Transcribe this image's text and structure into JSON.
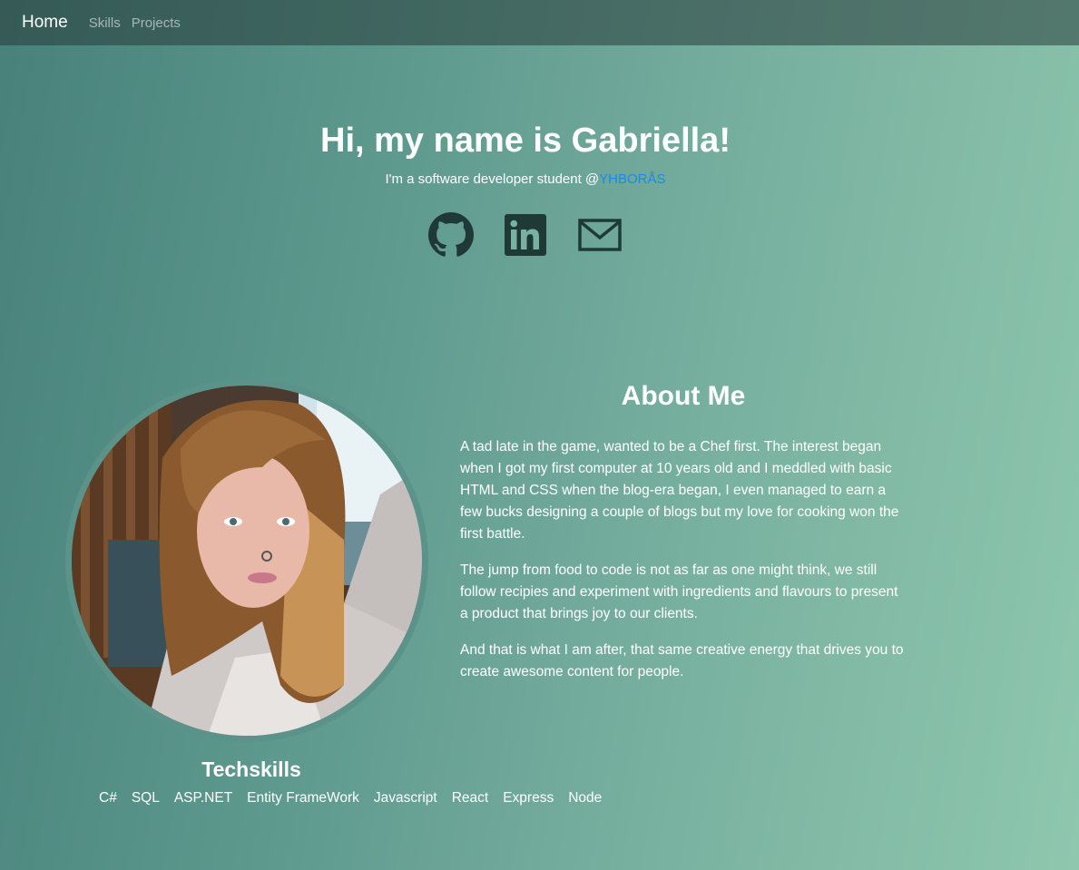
{
  "nav": {
    "brand": "Home",
    "links": [
      "Skills",
      "Projects"
    ]
  },
  "hero": {
    "title": "Hi, my name is Gabriella!",
    "subtitle_prefix": "I'm a software developer student @",
    "subtitle_link": "YHBORÅS",
    "social_icons": [
      "github-icon",
      "linkedin-icon",
      "mail-icon"
    ]
  },
  "about": {
    "title": "About Me",
    "paragraphs": [
      "A tad late in the game, wanted to be a Chef first. The interest began when I got my first computer at 10 years old and I meddled with basic HTML and CSS when the blog-era began, I even managed to earn a few bucks designing a couple of blogs but my love for cooking won the first battle.",
      "The jump from food to code is not as far as one might think, we still follow recipies and experiment with ingredients and flavours to present a product that brings joy to our clients.",
      "And that is what I am after, that same creative energy that drives you to create awesome content for people."
    ]
  },
  "skills": {
    "title": "Techskills",
    "items": [
      "C#",
      "SQL",
      "ASP.NET",
      "Entity FrameWork",
      "Javascript",
      "React",
      "Express",
      "Node"
    ]
  },
  "colors": {
    "link": "#1e88e5",
    "icon": "#1f3a36",
    "text": "#ffffff"
  }
}
